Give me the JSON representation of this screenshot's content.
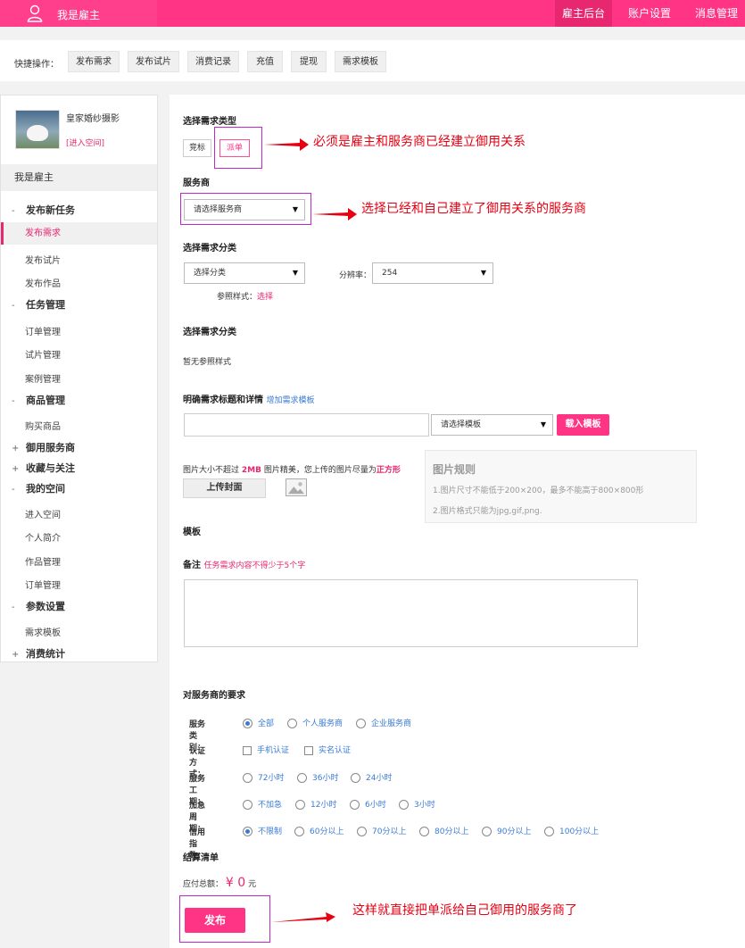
{
  "header": {
    "title": "我是雇主",
    "nav": [
      "雇主后台",
      "账户设置",
      "消息管理"
    ]
  },
  "quick": {
    "label": "快捷操作：",
    "buttons": [
      "发布需求",
      "发布试片",
      "消费记录",
      "充值",
      "提现",
      "需求模板"
    ]
  },
  "sidebar": {
    "shop_name": "皇家婚纱摄影",
    "enter_space": "[进入空间]",
    "role_title": "我是雇主",
    "groups": [
      {
        "pm": "-",
        "label": "发布新任务",
        "items": [
          "发布需求",
          "发布试片",
          "发布作品"
        ]
      },
      {
        "pm": "-",
        "label": "任务管理",
        "items": [
          "订单管理",
          "试片管理",
          "案例管理"
        ]
      },
      {
        "pm": "-",
        "label": "商品管理",
        "items": [
          "购买商品"
        ]
      },
      {
        "pm": "+",
        "label": "御用服务商",
        "items": []
      },
      {
        "pm": "+",
        "label": "收藏与关注",
        "items": []
      },
      {
        "pm": "-",
        "label": "我的空间",
        "items": [
          "进入空间",
          "个人简介",
          "作品管理",
          "订单管理"
        ]
      },
      {
        "pm": "-",
        "label": "参数设置",
        "items": [
          "需求模板"
        ]
      },
      {
        "pm": "+",
        "label": "消费统计",
        "items": []
      }
    ]
  },
  "form": {
    "type_title": "选择需求类型",
    "type_options": [
      "竞标",
      "派单"
    ],
    "provider_title": "服务商",
    "provider_select": "请选择服务商",
    "category_title": "选择需求分类",
    "category_select": "选择分类",
    "resolution_label": "分辨率：",
    "resolution_value": "254",
    "ref_label": "参照样式：",
    "ref_link": "选择",
    "category2_title": "选择需求分类",
    "no_ref": "暂无参照样式",
    "detail_title": "明确需求标题和详情",
    "add_template": "增加需求模板",
    "template_select": "请选择模板",
    "load_template": "载入模板",
    "img_tip_pre": "图片大小不超过",
    "img_tip_size": "2MB",
    "img_tip_mid": "图片精美，您上传的图片尽量为",
    "img_tip_shape": "正方形",
    "upload_cover": "上传封面",
    "rule_title": "图片规则",
    "rule_1": "1.图片尺寸不能低于200×200，最多不能高于800×800形",
    "rule_2": "2.图片格式只能为jpg,gif,png.",
    "template_title": "模板",
    "remark_title": "备注",
    "remark_tip": "任务需求内容不得少于5个字",
    "req_title": "对服务商的要求",
    "req_rows": [
      {
        "label": "服务类别：",
        "kind": "radio",
        "options": [
          "全部",
          "个人服务商",
          "企业服务商"
        ],
        "selected": 0
      },
      {
        "label": "认证方式：",
        "kind": "check",
        "options": [
          "手机认证",
          "实名认证"
        ],
        "selected": -1
      },
      {
        "label": "服务工期：",
        "kind": "radio",
        "options": [
          "72小时",
          "36小时",
          "24小时"
        ],
        "selected": -1
      },
      {
        "label": "加急周期：",
        "kind": "radio",
        "options": [
          "不加急",
          "12小时",
          "6小时",
          "3小时"
        ],
        "selected": -1
      },
      {
        "label": "信用指数：",
        "kind": "radio",
        "options": [
          "不限制",
          "60分以上",
          "70分以上",
          "80分以上",
          "90分以上",
          "100分以上"
        ],
        "selected": 0
      }
    ],
    "settle_title": "结算清单",
    "total_label": "应付总额：",
    "total_currency": "¥",
    "total_value": "0",
    "total_unit": "元",
    "publish": "发布"
  },
  "annotations": {
    "a1": "必须是雇主和服务商已经建立御用关系",
    "a2": "选择已经和自己建立了御用关系的服务商",
    "a3": "这样就直接把单派给自己御用的服务商了"
  },
  "colors": {
    "brand": "#ff3485",
    "annotation": "#e60012",
    "highlight": "#c028c8",
    "link": "#3a7bd5"
  }
}
